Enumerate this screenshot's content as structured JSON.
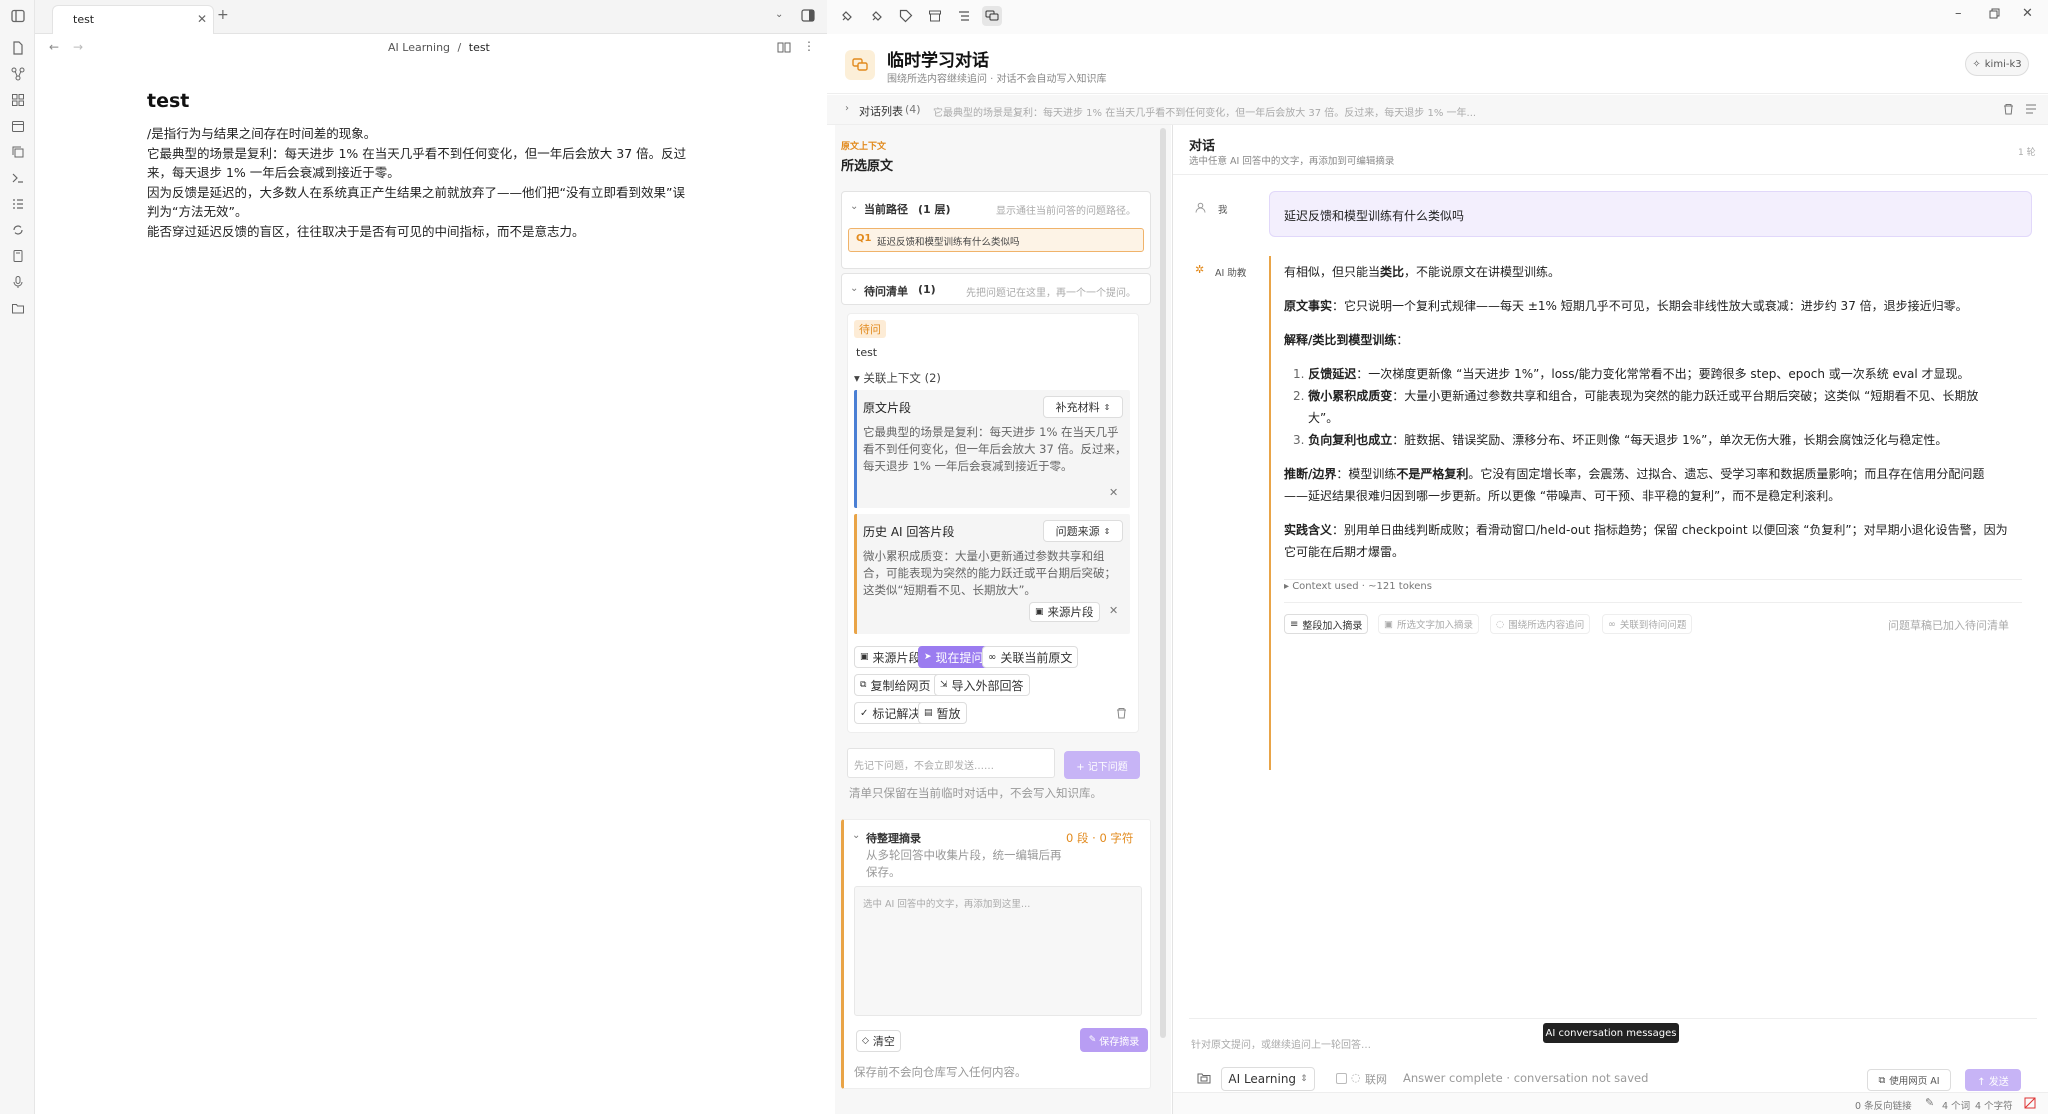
{
  "editor": {
    "tab_title": "test",
    "breadcrumb_folder": "AI Learning",
    "breadcrumb_sep": "/",
    "breadcrumb_file": "test",
    "doc_title": "test",
    "lines": [
      "/是指行为与结果之间存在时间差的现象。",
      "它最典型的场景是复利：每天进步 1% 在当天几乎看不到任何变化，但一年后会放大 37 倍。反过",
      "来，每天退步 1% 一年后会衰减到接近于零。",
      "因为反馈是延迟的，大多数人在系统真正产生结果之前就放弃了——他们把“没有立即看到效果”误",
      "判为“方法无效”。",
      "能否穿过延迟反馈的盲区，往往取决于是否有可见的中间指标，而不是意志力。"
    ]
  },
  "panel": {
    "title": "临时学习对话",
    "subtitle": "围绕所选内容继续追问 · 对话不会自动写入知识库",
    "model": "kimi-k3",
    "conv_list_label": "对话列表",
    "conv_count": "(4)",
    "conv_preview": "它最典型的场景是复利：每天进步 1% 在当天几乎看不到任何变化，但一年后会放大 37 倍。反过来，每天退步 1% 一年...",
    "context": {
      "eyebrow": "原文上下文",
      "title": "所选原文",
      "path_label": "当前路径",
      "path_count": "(1 层)",
      "path_hint": "显示通往当前问答的问题路径。",
      "path_q": "Q1",
      "path_q_text": "延迟反馈和模型训练有什么类似吗",
      "todo_label": "待问清单",
      "todo_count": "(1)",
      "todo_hint": "先把问题记在这里，再一个一个提问。",
      "todo_badge": "待问",
      "todo_text": "test",
      "linked_label": "▾ 关联上下文",
      "linked_count": "(2)",
      "snip1_title": "原文片段",
      "snip1_type": "补充材料",
      "snip1_body": "它最典型的场景是复利：每天进步 1% 在当天几乎看不到任何变化，但一年后会放大 37 倍。反过来，每天退步 1% 一年后会衰减到接近于零。",
      "snip2_title": "历史 AI 回答片段",
      "snip2_type": "问题来源",
      "snip2_body": "微小累积成质变：大量小更新通过参数共享和组合，可能表现为突然的能力跃迁或平台期后突破；这类似“短期看不见、长期放大”。",
      "snip2_source": "来源片段",
      "actions": [
        "来源片段",
        "现在提问",
        "关联当前原文",
        "复制给网页 AI",
        "导入外部回答",
        "标记解决",
        "暂放"
      ],
      "todo_input_placeholder": "先记下问题，不会立即发送……",
      "todo_add": "+ 记下问题",
      "todo_note": "清单只保留在当前临时对话中，不会写入知识库。",
      "excerpt_label": "待整理摘录",
      "excerpt_stats": "0 段 · 0 字符",
      "excerpt_hint": "从多轮回答中收集片段，统一编辑后再保存。",
      "excerpt_placeholder": "选中 AI 回答中的文字，再添加到这里…",
      "excerpt_clear": "清空",
      "excerpt_save": "保存摘录",
      "excerpt_note": "保存前不会向仓库写入任何内容。"
    },
    "chat": {
      "title": "对话",
      "hint": "选中任意 AI 回答中的文字，再添加到可编辑摘录",
      "turns": "1 轮",
      "me_label": "我",
      "me_text": "延迟反馈和模型训练有什么类似吗",
      "ai_label": "AI 助教",
      "ai_p1_pre": "有相似，但只能当",
      "ai_p1_bold": "类比",
      "ai_p1_post": "，不能说原文在讲模型训练。",
      "ai_p2_bold": "原文事实",
      "ai_p2": "：它只说明一个复利式规律——每天 ±1% 短期几乎不可见，长期会非线性放大或衰减：进步约 37 倍，退步接近归零。",
      "ai_p3_bold": "解释/类比到模型训练",
      "ai_p3": "：",
      "ai_li1_bold": "反馈延迟",
      "ai_li1": "：一次梯度更新像 “当天进步 1%”，loss/能力变化常常看不出；要跨很多 step、epoch 或一次系统 eval 才显现。",
      "ai_li2_bold": "微小累积成质变",
      "ai_li2a": "：大量小更新通过参数共享和组合，可能表现为突然的能力跃迁或平台期后突破；这类似 “短期看不见、长期放",
      "ai_li2b": "大”。",
      "ai_li3_bold": "负向复利也成立",
      "ai_li3": "：脏数据、错误奖励、漂移分布、坏正则像 “每天退步 1%”，单次无伤大雅，长期会腐蚀泛化与稳定性。",
      "ai_p4_bold": "推断/边界",
      "ai_p4_mid_pre": "：模型训练",
      "ai_p4_mid_bold": "不是严格复利",
      "ai_p4a": "。它没有固定增长率，会震荡、过拟合、遗忘、受学习率和数据质量影响；而且存在信用分配问题",
      "ai_p4b": "——延迟结果很难归因到哪一步更新。所以更像 “带噪声、可干预、非平稳的复利”，而不是稳定利滚利。",
      "ai_p5_bold": "实践含义",
      "ai_p5a": "：别用单日曲线判断成败；看滑动窗口/held-out 指标趋势；保留 checkpoint 以便回滚 “负复利”；对早期小退化设告警，因为",
      "ai_p5b": "它可能在后期才爆雷。",
      "context_used": "▸ Context used · ~121 tokens",
      "btn_whole": "整段加入摘录",
      "btn_sel": "所选文字加入摘录",
      "btn_ask": "围绕所选内容追问",
      "btn_link": "关联到待问问题",
      "draft_note": "问题草稿已加入待问清单",
      "input_placeholder": "针对原文提问，或继续追问上一轮回答…",
      "tooltip": "AI conversation messages",
      "folder": "AI Learning",
      "web_toggle": "联网",
      "status": "Answer complete · conversation not saved",
      "use_web_ai": "使用网页 AI",
      "send": "↑ 发送"
    },
    "statusbar": {
      "backlinks": "0 条反向链接",
      "words": "4 个词",
      "chars": "4 个字符"
    }
  },
  "colors": {
    "accent_purple": "#a88bef",
    "accent_orange": "#e9a447",
    "user_bubble": "#f3effd"
  }
}
